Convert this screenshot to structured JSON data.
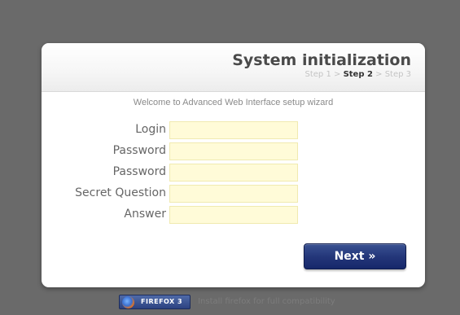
{
  "header": {
    "title": "System initialization",
    "steps": {
      "step1": "Step 1",
      "sep1": " > ",
      "step2": "Step 2",
      "sep2": " > ",
      "step3": "Step 3"
    }
  },
  "welcome": "Welcome to Advanced Web Interface setup wizard",
  "form": {
    "fields": [
      {
        "label": "Login",
        "value": ""
      },
      {
        "label": "Password",
        "value": ""
      },
      {
        "label": "Password",
        "value": ""
      },
      {
        "label": "Secret Question",
        "value": ""
      },
      {
        "label": "Answer",
        "value": ""
      }
    ]
  },
  "next_button": "Next »",
  "footer": {
    "badge_text": "FIREFOX 3",
    "badge_icon": "firefox-icon",
    "message": "Install firefox for full compatibility"
  },
  "colors": {
    "background": "#6a6a6a",
    "input_bg": "#fffbd8",
    "button": "#24377a"
  }
}
